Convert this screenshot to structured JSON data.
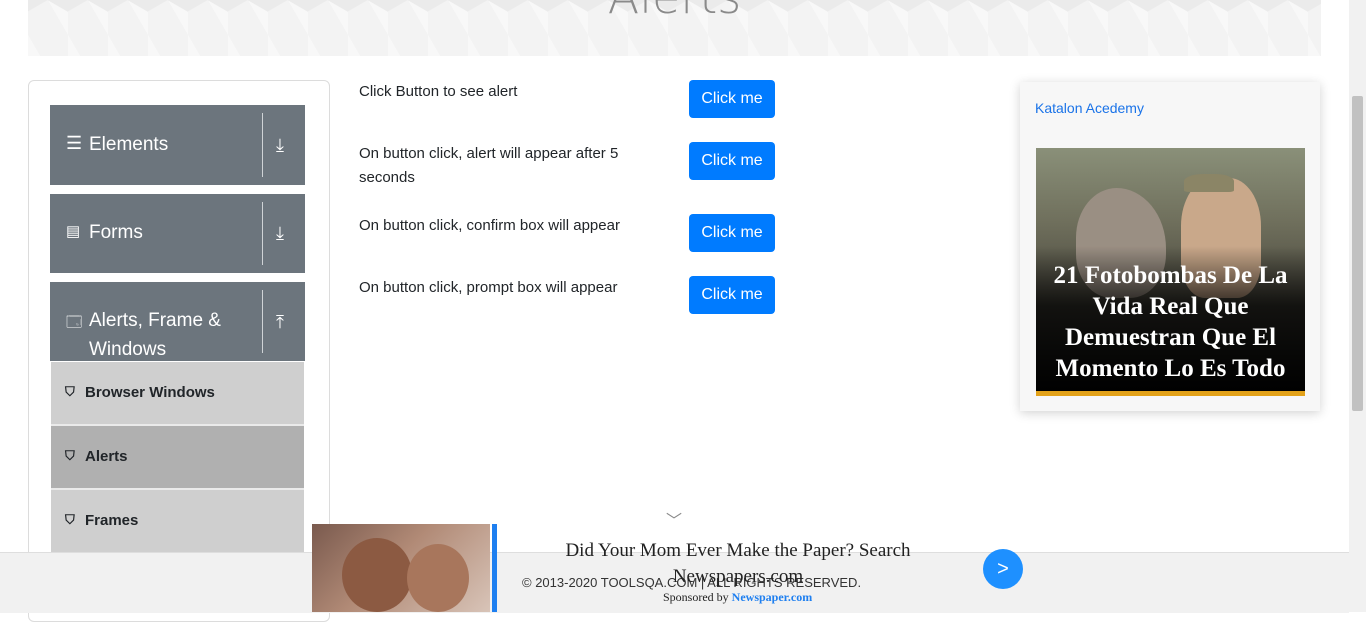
{
  "banner": {
    "title": "Alerts"
  },
  "sidebar": {
    "groups": [
      {
        "label": "Elements",
        "icon": "menu-icon",
        "arrow": "download-icon"
      },
      {
        "label": "Forms",
        "icon": "document-icon",
        "arrow": "download-icon"
      },
      {
        "label_line1": "Alerts, Frame &",
        "label_line2": "Windows",
        "icon": "window-icon",
        "arrow": "upload-icon"
      }
    ],
    "items": [
      {
        "label": "Browser Windows",
        "icon": "html5-icon"
      },
      {
        "label": "Alerts",
        "icon": "html5-icon",
        "active": true
      },
      {
        "label": "Frames",
        "icon": "html5-icon"
      }
    ]
  },
  "main": {
    "rows": [
      {
        "text": "Click Button to see alert",
        "button": "Click me"
      },
      {
        "text": "On button click, alert will appear after 5 seconds",
        "button": "Click me"
      },
      {
        "text": "On button click, confirm box will appear",
        "button": "Click me"
      },
      {
        "text": "On button click, prompt box will appear",
        "button": "Click me"
      }
    ]
  },
  "side_ad": {
    "link_text": "Katalon Acedemy",
    "caption": "21 Fotobombas De La Vida Real Que Demuestran Que El Momento Lo Es Todo"
  },
  "footer": {
    "copyright": "© 2013-2020 TOOLSQA.COM | ALL RIGHTS RESERVED."
  },
  "bottom_ad": {
    "headline": "Did Your Mom Ever Make the Paper? Search Newspapers.com",
    "sponsored_prefix": "Sponsored by",
    "sponsor": "Newspaper.com",
    "next_label": ">"
  },
  "colors": {
    "primary": "#007bff",
    "sidebar_group": "#6c757d",
    "submenu": "#cfcfcf",
    "submenu_active": "#b0b0b0"
  }
}
